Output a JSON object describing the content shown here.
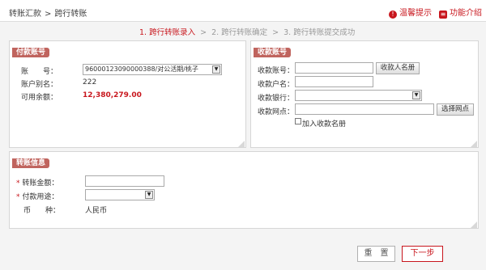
{
  "header": {
    "breadcrumb": [
      "转账汇款",
      "跨行转账"
    ],
    "breadcrumb_sep": ">",
    "tip_link": "温馨提示",
    "intro_link": "功能介绍"
  },
  "steps": {
    "items": [
      "1. 跨行转账录入",
      "2. 跨行转账确定",
      "3. 跨行转账提交成功"
    ],
    "separator": ">"
  },
  "payer": {
    "title": "付款账号",
    "account_label": "账　　号：",
    "account_value": "96000123090000388/对公活期/桃子",
    "alias_label": "账户别名：",
    "alias_value": "222",
    "balance_label": "可用余额：",
    "balance_value": "12,380,279.00"
  },
  "payee": {
    "title": "收款账号",
    "account_label": "收款账号：",
    "name_book_button": "收款人名册",
    "name_label": "收款户名：",
    "bank_label": "收款银行：",
    "branch_label": "收款网点：",
    "choose_branch_button": "选择网点",
    "add_to_book_label": "加入收款名册"
  },
  "transfer": {
    "title": "转账信息",
    "amount_label": "转账金额：",
    "purpose_label": "付款用途：",
    "currency_label": "币　　种：",
    "currency_value": "人民币"
  },
  "buttons": {
    "reset": "重　置",
    "next": "下一步"
  },
  "colors": {
    "accent": "#c8161d",
    "panel_title_bg": "#c0645e"
  }
}
